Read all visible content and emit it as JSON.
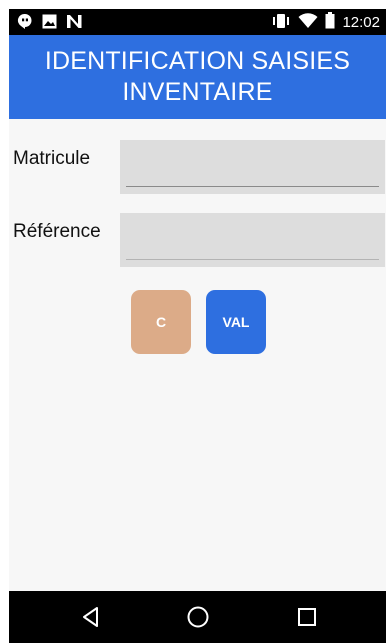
{
  "status_bar": {
    "time": "12:02",
    "left_icons": [
      "hangouts-icon",
      "image-icon",
      "n-logo-icon"
    ],
    "right_icons": [
      "vibrate-icon",
      "wifi-icon",
      "battery-icon"
    ]
  },
  "header": {
    "title": "IDENTIFICATION SAISIES INVENTAIRE",
    "background_color": "#2e6fe0"
  },
  "form": {
    "matricule": {
      "label": "Matricule",
      "value": "",
      "placeholder": ""
    },
    "reference": {
      "label": "Référence",
      "value": "",
      "placeholder": ""
    }
  },
  "buttons": {
    "clear": {
      "label": "C",
      "color": "#dcab88"
    },
    "validate": {
      "label": "VAL",
      "color": "#2e6fe0"
    }
  },
  "nav_bar": {
    "buttons": [
      "back-icon",
      "home-icon",
      "recents-icon"
    ]
  }
}
